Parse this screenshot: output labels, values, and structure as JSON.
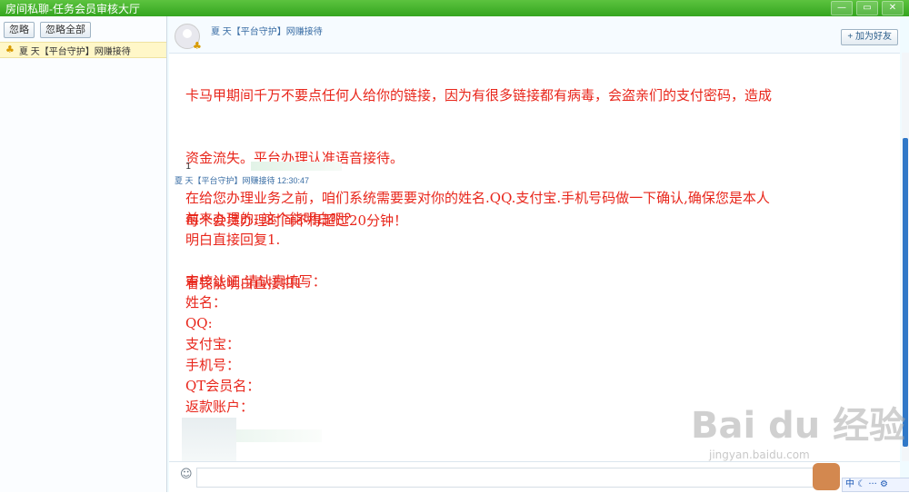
{
  "window": {
    "title": "房间私聊-任务会员审核大厅",
    "controls": [
      "—",
      "▭",
      "✕"
    ]
  },
  "sidebar": {
    "buttons": [
      "忽略",
      "忽略全部"
    ],
    "contact": "夏 天【平台守护】网赚接待"
  },
  "chat_header": {
    "contact_name": "夏 天【平台守护】网赚接待",
    "add_friend": "+ 加为好友"
  },
  "messages": [
    {
      "lines": [
        "卡马甲期间千万不要点任何人给你的链接，因为有很多链接都有病毒，会盗亲们的支付密码，造成",
        "资金流失。平台办理认准语音接待。",
        "      每个会员办理时间不得超过20分钟！",
        "看完能明白直接扣1"
      ]
    },
    {
      "prefix": "1",
      "meta": "夏 天【平台守护】网赚接待  12:30:47",
      "lines": [
        "在给您办理业务之前，咱们系统需要要对你的姓名.QQ.支付宝.手机号码做一下确认,确保您是本人",
        "前来办理的.  这个能明白吧？",
        "明白直接回复1.",
        "",
        "审核认证.请认真填写：",
        "姓名：",
        "QQ:",
        "支付宝：",
        "手机号：",
        "QT会员名：",
        "返款账户："
      ]
    }
  ],
  "tray": {
    "ime": "中 ☾ ··· ⚙"
  },
  "watermark": {
    "main": "Bai du 经验",
    "sub": "jingyan.baidu.com"
  },
  "colors": {
    "titlebar": "#34a51f",
    "message_text": "#e8261b",
    "scroll_thumb": "#2f78c8"
  }
}
